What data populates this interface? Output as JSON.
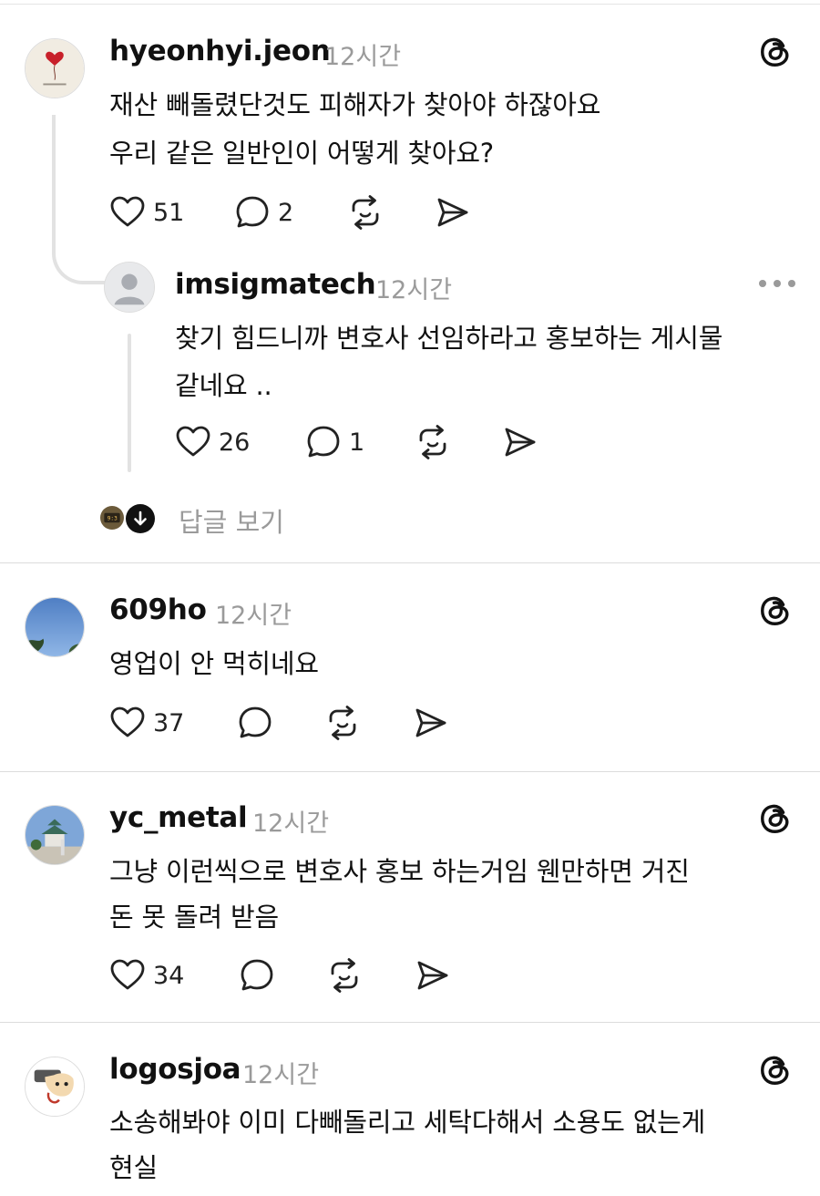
{
  "posts": [
    {
      "username": "hyeonhyi.jeon",
      "time": "12시간",
      "lines": [
        "재산 빼돌렸단것도 피해자가 찾아야 하잖아요",
        "우리 같은 일반인이 어떻게 찾아요?"
      ],
      "likes": "51",
      "replies": "2",
      "avatar_icon": "balloon-avatar-icon",
      "reply": {
        "username": "imsigmatech",
        "time": "12시간",
        "lines": [
          "찾기 힘드니까 변호사 선임하라고 홍보하는 게시물",
          "같네요 .."
        ],
        "likes": "26",
        "replies": "1",
        "avatar_icon": "default-person-avatar-icon"
      },
      "more_replies_label": "답글 보기"
    },
    {
      "username": "609ho",
      "time": "12시간",
      "lines": [
        "영업이 안 먹히네요"
      ],
      "likes": "37",
      "avatar_icon": "sky-avatar-icon"
    },
    {
      "username": "yc_metal",
      "time": "12시간",
      "lines": [
        "그냥 이런씩으로 변호사 홍보 하는거임  웬만하면 거진",
        "돈 못 돌려 받음"
      ],
      "likes": "34",
      "avatar_icon": "castle-avatar-icon"
    },
    {
      "username": "logosjoa",
      "time": "12시간",
      "lines": [
        "소송해봐야 이미 다빼돌리고 세탁다해서 소용도 없는게",
        "현실"
      ],
      "avatar_icon": "cartoon-avatar-icon"
    }
  ],
  "icons": {
    "like": "heart-icon",
    "reply": "comment-bubble-icon",
    "repost": "repost-icon",
    "share": "send-icon",
    "brand": "threads-logo-icon",
    "menu": "more-options-icon"
  },
  "colors": {
    "text": "#111111",
    "muted": "#9a9a9a",
    "divider": "#dcdcdc",
    "thread_line": "#e2e2e2"
  }
}
